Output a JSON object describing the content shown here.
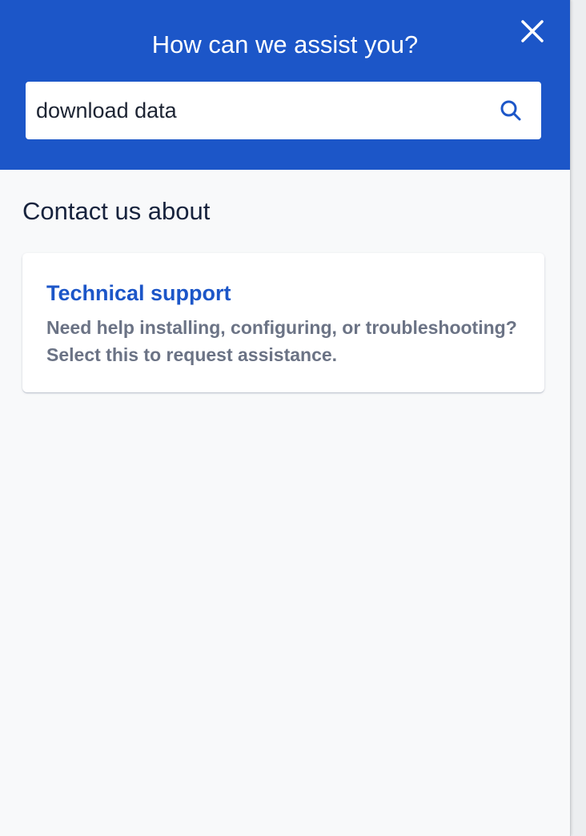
{
  "header": {
    "title": "How can we assist you?",
    "close_icon": "close-icon"
  },
  "search": {
    "value": "download data",
    "placeholder": "",
    "icon": "search-icon"
  },
  "contact": {
    "section_title": "Contact us about",
    "options": [
      {
        "title": "Technical support",
        "description": "Need help installing, configuring, or troubleshooting? Select this to request assistance."
      }
    ]
  },
  "colors": {
    "brand": "#1c56c8",
    "panel_background": "#f8f9fa",
    "heading_text": "#17233d",
    "muted_text": "#6b7385"
  }
}
